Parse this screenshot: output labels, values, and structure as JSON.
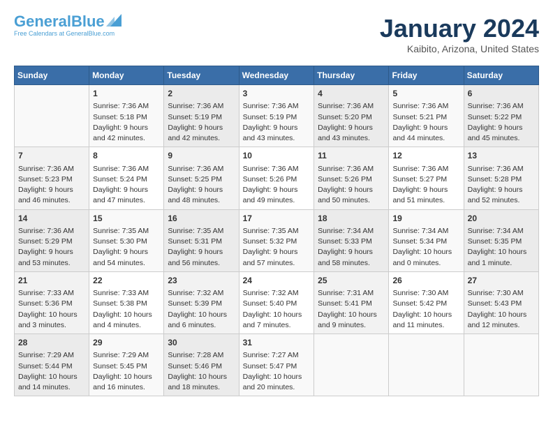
{
  "header": {
    "logo_general": "General",
    "logo_blue": "Blue",
    "month_title": "January 2024",
    "location": "Kaibito, Arizona, United States"
  },
  "days_of_week": [
    "Sunday",
    "Monday",
    "Tuesday",
    "Wednesday",
    "Thursday",
    "Friday",
    "Saturday"
  ],
  "weeks": [
    [
      {
        "day": "",
        "sunrise": "",
        "sunset": "",
        "daylight": ""
      },
      {
        "day": "1",
        "sunrise": "Sunrise: 7:36 AM",
        "sunset": "Sunset: 5:18 PM",
        "daylight": "Daylight: 9 hours and 42 minutes."
      },
      {
        "day": "2",
        "sunrise": "Sunrise: 7:36 AM",
        "sunset": "Sunset: 5:19 PM",
        "daylight": "Daylight: 9 hours and 42 minutes."
      },
      {
        "day": "3",
        "sunrise": "Sunrise: 7:36 AM",
        "sunset": "Sunset: 5:19 PM",
        "daylight": "Daylight: 9 hours and 43 minutes."
      },
      {
        "day": "4",
        "sunrise": "Sunrise: 7:36 AM",
        "sunset": "Sunset: 5:20 PM",
        "daylight": "Daylight: 9 hours and 43 minutes."
      },
      {
        "day": "5",
        "sunrise": "Sunrise: 7:36 AM",
        "sunset": "Sunset: 5:21 PM",
        "daylight": "Daylight: 9 hours and 44 minutes."
      },
      {
        "day": "6",
        "sunrise": "Sunrise: 7:36 AM",
        "sunset": "Sunset: 5:22 PM",
        "daylight": "Daylight: 9 hours and 45 minutes."
      }
    ],
    [
      {
        "day": "7",
        "sunrise": "Sunrise: 7:36 AM",
        "sunset": "Sunset: 5:23 PM",
        "daylight": "Daylight: 9 hours and 46 minutes."
      },
      {
        "day": "8",
        "sunrise": "Sunrise: 7:36 AM",
        "sunset": "Sunset: 5:24 PM",
        "daylight": "Daylight: 9 hours and 47 minutes."
      },
      {
        "day": "9",
        "sunrise": "Sunrise: 7:36 AM",
        "sunset": "Sunset: 5:25 PM",
        "daylight": "Daylight: 9 hours and 48 minutes."
      },
      {
        "day": "10",
        "sunrise": "Sunrise: 7:36 AM",
        "sunset": "Sunset: 5:26 PM",
        "daylight": "Daylight: 9 hours and 49 minutes."
      },
      {
        "day": "11",
        "sunrise": "Sunrise: 7:36 AM",
        "sunset": "Sunset: 5:26 PM",
        "daylight": "Daylight: 9 hours and 50 minutes."
      },
      {
        "day": "12",
        "sunrise": "Sunrise: 7:36 AM",
        "sunset": "Sunset: 5:27 PM",
        "daylight": "Daylight: 9 hours and 51 minutes."
      },
      {
        "day": "13",
        "sunrise": "Sunrise: 7:36 AM",
        "sunset": "Sunset: 5:28 PM",
        "daylight": "Daylight: 9 hours and 52 minutes."
      }
    ],
    [
      {
        "day": "14",
        "sunrise": "Sunrise: 7:36 AM",
        "sunset": "Sunset: 5:29 PM",
        "daylight": "Daylight: 9 hours and 53 minutes."
      },
      {
        "day": "15",
        "sunrise": "Sunrise: 7:35 AM",
        "sunset": "Sunset: 5:30 PM",
        "daylight": "Daylight: 9 hours and 54 minutes."
      },
      {
        "day": "16",
        "sunrise": "Sunrise: 7:35 AM",
        "sunset": "Sunset: 5:31 PM",
        "daylight": "Daylight: 9 hours and 56 minutes."
      },
      {
        "day": "17",
        "sunrise": "Sunrise: 7:35 AM",
        "sunset": "Sunset: 5:32 PM",
        "daylight": "Daylight: 9 hours and 57 minutes."
      },
      {
        "day": "18",
        "sunrise": "Sunrise: 7:34 AM",
        "sunset": "Sunset: 5:33 PM",
        "daylight": "Daylight: 9 hours and 58 minutes."
      },
      {
        "day": "19",
        "sunrise": "Sunrise: 7:34 AM",
        "sunset": "Sunset: 5:34 PM",
        "daylight": "Daylight: 10 hours and 0 minutes."
      },
      {
        "day": "20",
        "sunrise": "Sunrise: 7:34 AM",
        "sunset": "Sunset: 5:35 PM",
        "daylight": "Daylight: 10 hours and 1 minute."
      }
    ],
    [
      {
        "day": "21",
        "sunrise": "Sunrise: 7:33 AM",
        "sunset": "Sunset: 5:36 PM",
        "daylight": "Daylight: 10 hours and 3 minutes."
      },
      {
        "day": "22",
        "sunrise": "Sunrise: 7:33 AM",
        "sunset": "Sunset: 5:38 PM",
        "daylight": "Daylight: 10 hours and 4 minutes."
      },
      {
        "day": "23",
        "sunrise": "Sunrise: 7:32 AM",
        "sunset": "Sunset: 5:39 PM",
        "daylight": "Daylight: 10 hours and 6 minutes."
      },
      {
        "day": "24",
        "sunrise": "Sunrise: 7:32 AM",
        "sunset": "Sunset: 5:40 PM",
        "daylight": "Daylight: 10 hours and 7 minutes."
      },
      {
        "day": "25",
        "sunrise": "Sunrise: 7:31 AM",
        "sunset": "Sunset: 5:41 PM",
        "daylight": "Daylight: 10 hours and 9 minutes."
      },
      {
        "day": "26",
        "sunrise": "Sunrise: 7:30 AM",
        "sunset": "Sunset: 5:42 PM",
        "daylight": "Daylight: 10 hours and 11 minutes."
      },
      {
        "day": "27",
        "sunrise": "Sunrise: 7:30 AM",
        "sunset": "Sunset: 5:43 PM",
        "daylight": "Daylight: 10 hours and 12 minutes."
      }
    ],
    [
      {
        "day": "28",
        "sunrise": "Sunrise: 7:29 AM",
        "sunset": "Sunset: 5:44 PM",
        "daylight": "Daylight: 10 hours and 14 minutes."
      },
      {
        "day": "29",
        "sunrise": "Sunrise: 7:29 AM",
        "sunset": "Sunset: 5:45 PM",
        "daylight": "Daylight: 10 hours and 16 minutes."
      },
      {
        "day": "30",
        "sunrise": "Sunrise: 7:28 AM",
        "sunset": "Sunset: 5:46 PM",
        "daylight": "Daylight: 10 hours and 18 minutes."
      },
      {
        "day": "31",
        "sunrise": "Sunrise: 7:27 AM",
        "sunset": "Sunset: 5:47 PM",
        "daylight": "Daylight: 10 hours and 20 minutes."
      },
      {
        "day": "",
        "sunrise": "",
        "sunset": "",
        "daylight": ""
      },
      {
        "day": "",
        "sunrise": "",
        "sunset": "",
        "daylight": ""
      },
      {
        "day": "",
        "sunrise": "",
        "sunset": "",
        "daylight": ""
      }
    ]
  ]
}
